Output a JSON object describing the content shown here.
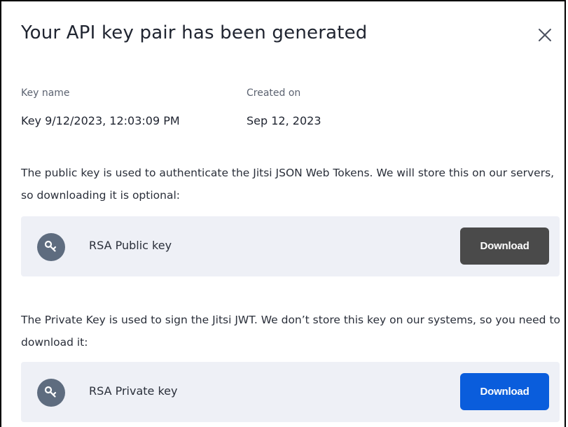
{
  "modal": {
    "title": "Your API key pair has been generated",
    "close_icon": "close-icon"
  },
  "meta": {
    "key_name_label": "Key name",
    "key_name_value": "Key 9/12/2023, 12:03:09 PM",
    "created_on_label": "Created on",
    "created_on_value": "Sep 12, 2023"
  },
  "public_key": {
    "description": "The public key is used to authenticate the Jitsi JSON Web Tokens. We will store this on our servers, so downloading it is optional:",
    "label": "RSA Public key",
    "icon": "key-icon",
    "download_label": "Download",
    "button_color": "#4a4a4a"
  },
  "private_key": {
    "description": "The Private Key is used to sign the Jitsi JWT. We don’t store this key on our systems, so you need to download it:",
    "label": "RSA Private key",
    "icon": "key-icon",
    "download_label": "Download",
    "button_color": "#0a5ddc"
  },
  "colors": {
    "row_background": "#eef0f6",
    "avatar_background": "#5e6c7f"
  }
}
